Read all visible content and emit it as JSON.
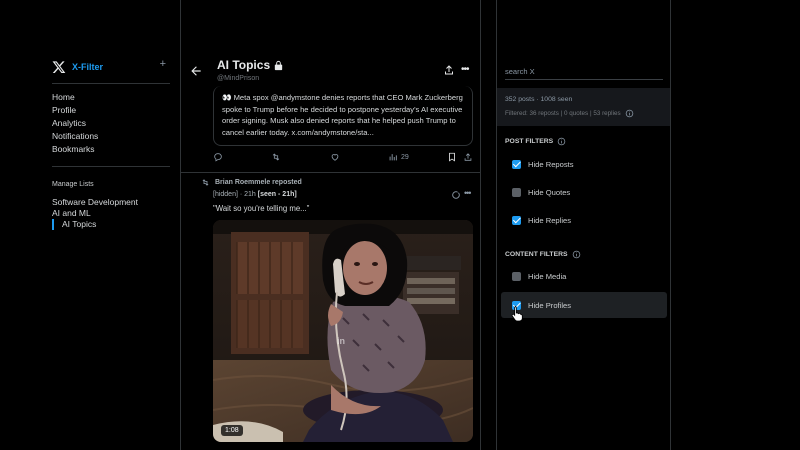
{
  "sidebar": {
    "brand": "X-Filter",
    "add_symbol": "+",
    "nav": [
      "Home",
      "Profile",
      "Analytics",
      "Notifications",
      "Bookmarks"
    ],
    "manage_lists_title": "Manage Lists",
    "lists": [
      "Software Development",
      "AI and ML",
      "AI Topics"
    ]
  },
  "header": {
    "title": "AI Topics",
    "handle": "@MindPrison"
  },
  "quoted_tweet": {
    "emoji": "👀",
    "text": "Meta spox @andymstone denies reports that CEO Mark Zuckerberg spoke to Trump before he decided to postpone yesterday's AI executive order signing. Musk also denied reports that he helped push Trump to cancel earlier today. x.com/andymstone/sta..."
  },
  "actions": {
    "views": "29"
  },
  "tweet": {
    "reposted_by": "Brian Roemmele reposted",
    "author": "[hidden]",
    "time": "· 21h",
    "seen": "[seen - 21h]",
    "text": "\"Wait so you're telling me...\"",
    "video_duration": "1:08"
  },
  "panel": {
    "search_placeholder": "search X",
    "stats_main": "352 posts · 1008 seen",
    "stats_sub": "Filtered: 36 reposts | 0 quotes | 53 replies",
    "post_filters_title": "POST FILTERS",
    "post_filters": [
      {
        "label": "Hide Reposts",
        "checked": true
      },
      {
        "label": "Hide Quotes",
        "checked": false
      },
      {
        "label": "Hide Replies",
        "checked": true
      }
    ],
    "content_filters_title": "CONTENT FILTERS",
    "content_filters": [
      {
        "label": "Hide Media",
        "checked": false
      },
      {
        "label": "Hide Profiles",
        "checked": true
      }
    ]
  },
  "colors": {
    "accent": "#1d9bf0",
    "background": "#000000",
    "border": "#2f3336"
  }
}
